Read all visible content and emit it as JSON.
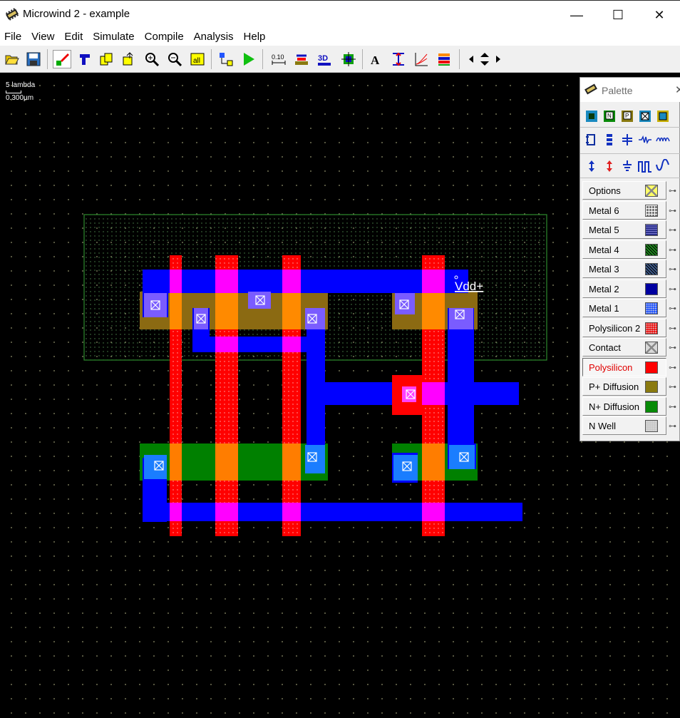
{
  "window": {
    "title": "Microwind 2 - example",
    "minimize": "—",
    "maximize": "☐",
    "close": "✕"
  },
  "menu": [
    "File",
    "View",
    "Edit",
    "Simulate",
    "Compile",
    "Analysis",
    "Help"
  ],
  "toolbar": {
    "icons": [
      "open-icon",
      "save-icon",
      "draw-icon",
      "move-icon",
      "copy-icon",
      "stretch-icon",
      "zoom-in-icon",
      "zoom-out-icon",
      "view-all-icon",
      "connect-icon",
      "run-simulation-icon",
      "measure-icon",
      "cross-section-icon",
      "3d-view-icon",
      "navigator-icon",
      "text-icon",
      "vertical-cut-icon",
      "chart-icon",
      "layers-icon",
      "arrows-icon"
    ],
    "measure_label": "0.10",
    "view3d_label": "3D",
    "text_label": "A"
  },
  "canvas": {
    "scale_lambda": "5 lambda",
    "scale_um": "0.300µm",
    "node_label": "Vdd+"
  },
  "palette": {
    "title": "Palette",
    "close": "✕",
    "device_row1": [
      "nmos-contact-icon",
      "n-contact-icon",
      "p-contact-icon",
      "via-icon",
      "diff-contact-icon"
    ],
    "device_row2": [
      "pad-icon",
      "capacitor-icon",
      "ground-icon",
      "resistor-icon",
      "inductor-icon"
    ],
    "device_row3": [
      "supply-icon",
      "clock-icon",
      "pulse-icon",
      "sine-icon",
      "visible-icon"
    ],
    "layers": [
      {
        "label": "Options",
        "swatch": "#ffff66",
        "pattern": "cross"
      },
      {
        "label": "Metal 6",
        "swatch": "#777777",
        "pattern": "grid"
      },
      {
        "label": "Metal 5",
        "swatch": "#2b2f8a",
        "pattern": "hlines"
      },
      {
        "label": "Metal 4",
        "swatch": "#1f8a1f",
        "pattern": "diag"
      },
      {
        "label": "Metal 3",
        "swatch": "#3d5a8a",
        "pattern": "diag"
      },
      {
        "label": "Metal 2",
        "swatch": "#0000a0",
        "pattern": "solid"
      },
      {
        "label": "Metal 1",
        "swatch": "#2255ff",
        "pattern": "dots"
      },
      {
        "label": "Polysilicon 2",
        "swatch": "#ee1111",
        "pattern": "dots"
      },
      {
        "label": "Contact",
        "swatch": "#d8d8d8",
        "pattern": "cross"
      },
      {
        "label": "Polysilicon",
        "swatch": "#ff0000",
        "pattern": "solid",
        "selected": true
      },
      {
        "label": "P+ Diffusion",
        "swatch": "#8a7a10",
        "pattern": "solid"
      },
      {
        "label": "N+ Diffusion",
        "swatch": "#078a07",
        "pattern": "solid"
      },
      {
        "label": "N Well",
        "swatch": "#c8c8c8",
        "pattern": "dots"
      }
    ]
  },
  "colors": {
    "polysilicon": "#ff0000",
    "metal1": "#0000ff",
    "p_diffusion": "#8b6a12",
    "n_diffusion": "#008000",
    "nwell_outline": "#2d8a2d",
    "gate_p": "#ff8a00",
    "gate_n": "#ff7d00",
    "contact_overlay": "#7a5cff",
    "poly_contact": "#ff40ff",
    "canvas": "#000000"
  }
}
